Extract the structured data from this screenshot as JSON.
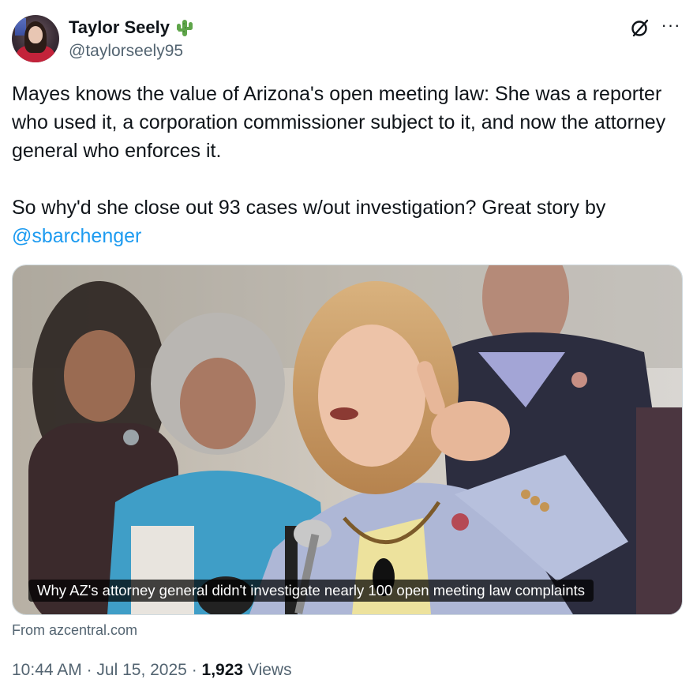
{
  "author": {
    "display_name": "Taylor Seely",
    "emoji": "cactus",
    "handle": "@taylorseely95"
  },
  "icons": {
    "grok": "grok-slash-circle-icon",
    "more": "more-horizontal-icon",
    "more_glyph": "···"
  },
  "tweet": {
    "paragraph_1": "Mayes knows the value of Arizona's open meeting law: She was a reporter who used it, a corporation commissioner subject to it, and now the attorney general who enforces it.",
    "paragraph_2": "So why'd she close out 93 cases w/out investigation? Great story by",
    "mention": "@sbarchenger"
  },
  "link_card": {
    "title": "Why AZ's attorney general didn't investigate nearly 100 open meeting law complaints",
    "source": "From azcentral.com"
  },
  "meta": {
    "time": "10:44 AM",
    "separator": "·",
    "date": "Jul 15, 2025",
    "views_count": "1,923",
    "views_label": "Views"
  },
  "colors": {
    "text": "#0f1419",
    "secondary": "#536471",
    "link": "#1d9bf0"
  }
}
